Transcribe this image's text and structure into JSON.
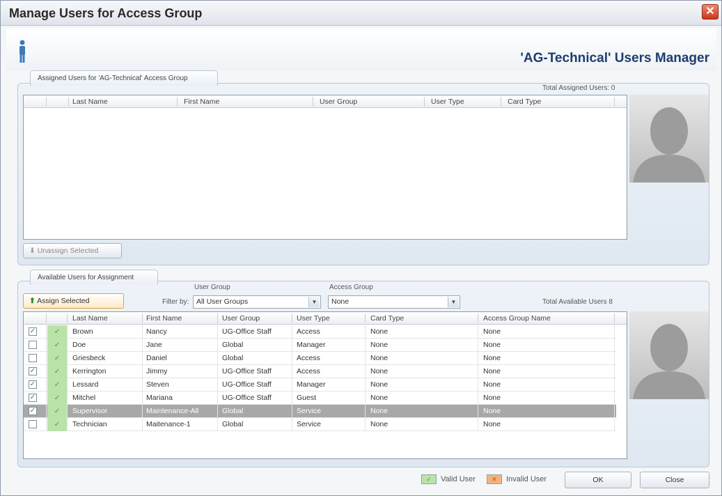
{
  "window": {
    "title": "Manage Users for Access Group",
    "close_glyph": "✕"
  },
  "header": {
    "manager_title": "'AG-Technical' Users Manager",
    "icon": "person-icon"
  },
  "assigned": {
    "tab_label": "Assigned Users for 'AG-Technical' Access Group",
    "total_label": "Total Assigned Users: 0",
    "columns": [
      "Last Name",
      "First Name",
      "User Group",
      "User Type",
      "Card Type"
    ],
    "unassign_label": "Unassign Selected"
  },
  "available": {
    "tab_label": "Available Users for Assignment",
    "assign_label": "Assign Selected",
    "user_group_label": "User Group",
    "filter_by_label": "Filter by:",
    "user_group_value": "All User Groups",
    "access_group_label": "Access Group",
    "access_group_value": "None",
    "total_label": "Total Available Users 8",
    "columns": [
      "Last Name",
      "First Name",
      "User Group",
      "User Type",
      "Card Type",
      "Access Group Name"
    ],
    "rows": [
      {
        "checked": true,
        "last": "Brown",
        "first": "Nancy",
        "group": "UG-Office Staff",
        "type": "Access",
        "card": "None",
        "access_group": "None",
        "selected": false
      },
      {
        "checked": false,
        "last": "Doe",
        "first": "Jane",
        "group": "Global",
        "type": "Manager",
        "card": "None",
        "access_group": "None",
        "selected": false
      },
      {
        "checked": false,
        "last": "Griesbeck",
        "first": "Daniel",
        "group": "Global",
        "type": "Access",
        "card": "None",
        "access_group": "None",
        "selected": false
      },
      {
        "checked": true,
        "last": "Kerrington",
        "first": "Jimmy",
        "group": "UG-Office Staff",
        "type": "Access",
        "card": "None",
        "access_group": "None",
        "selected": false
      },
      {
        "checked": true,
        "last": "Lessard",
        "first": "Steven",
        "group": "UG-Office Staff",
        "type": "Manager",
        "card": "None",
        "access_group": "None",
        "selected": false
      },
      {
        "checked": true,
        "last": "Mitchel",
        "first": "Mariana",
        "group": "UG-Office Staff",
        "type": "Guest",
        "card": "None",
        "access_group": "None",
        "selected": false
      },
      {
        "checked": true,
        "last": "Supervisor",
        "first": "Maintenance-All",
        "group": "Global",
        "type": "Service",
        "card": "None",
        "access_group": "None",
        "selected": true
      },
      {
        "checked": false,
        "last": "Technician",
        "first": "Maitenance-1",
        "group": "Global",
        "type": "Service",
        "card": "None",
        "access_group": "None",
        "selected": false
      }
    ]
  },
  "footer": {
    "valid_label": "Valid User",
    "invalid_label": "Invalid User",
    "ok_label": "OK",
    "close_label": "Close"
  },
  "colors": {
    "valid_green": "#b9e3a8",
    "invalid_orange": "#f6b27a",
    "title_blue": "#1f3d6e",
    "selected_row": "#a8a8a8"
  }
}
